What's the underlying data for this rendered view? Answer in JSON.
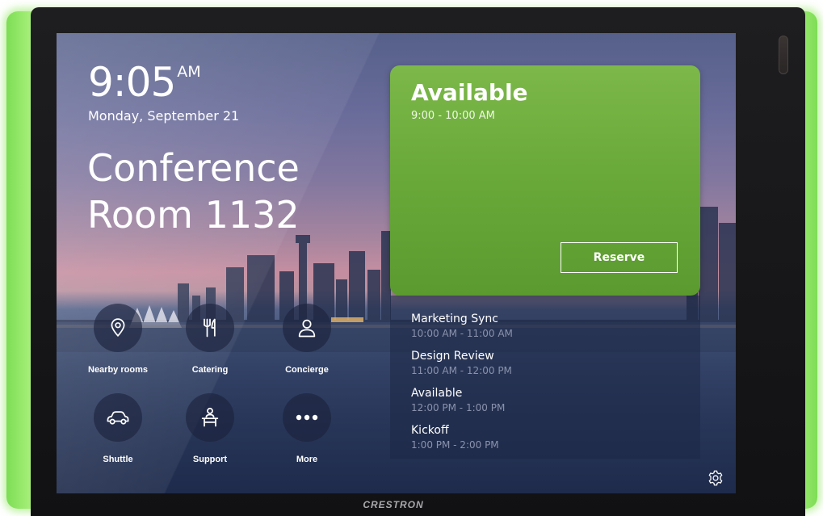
{
  "device": {
    "brand": "CRESTRON",
    "accent_glow": "#a7f07a"
  },
  "clock": {
    "time": "9:05",
    "ampm": "AM",
    "date": "Monday, September 21"
  },
  "room": {
    "name_line1": "Conference",
    "name_line2": "Room 1132"
  },
  "tiles": [
    {
      "label": "Nearby rooms",
      "icon": "map-pin-icon"
    },
    {
      "label": "Catering",
      "icon": "utensils-icon"
    },
    {
      "label": "Concierge",
      "icon": "person-icon"
    },
    {
      "label": "Shuttle",
      "icon": "car-icon"
    },
    {
      "label": "Support",
      "icon": "desk-support-icon"
    },
    {
      "label": "More",
      "icon": "more-dots-icon"
    }
  ],
  "status": {
    "title": "Available",
    "time": "9:00 - 10:00 AM",
    "color": "#6aaa3a",
    "reserve_label": "Reserve"
  },
  "schedule": [
    {
      "name": "Marketing Sync",
      "time": "10:00 AM - 11:00 AM"
    },
    {
      "name": "Design Review",
      "time": "11:00 AM - 12:00 PM"
    },
    {
      "name": "Available",
      "time": "12:00 PM - 1:00 PM"
    },
    {
      "name": "Kickoff",
      "time": "1:00 PM - 2:00 PM"
    }
  ],
  "settings_icon": "gear-icon"
}
